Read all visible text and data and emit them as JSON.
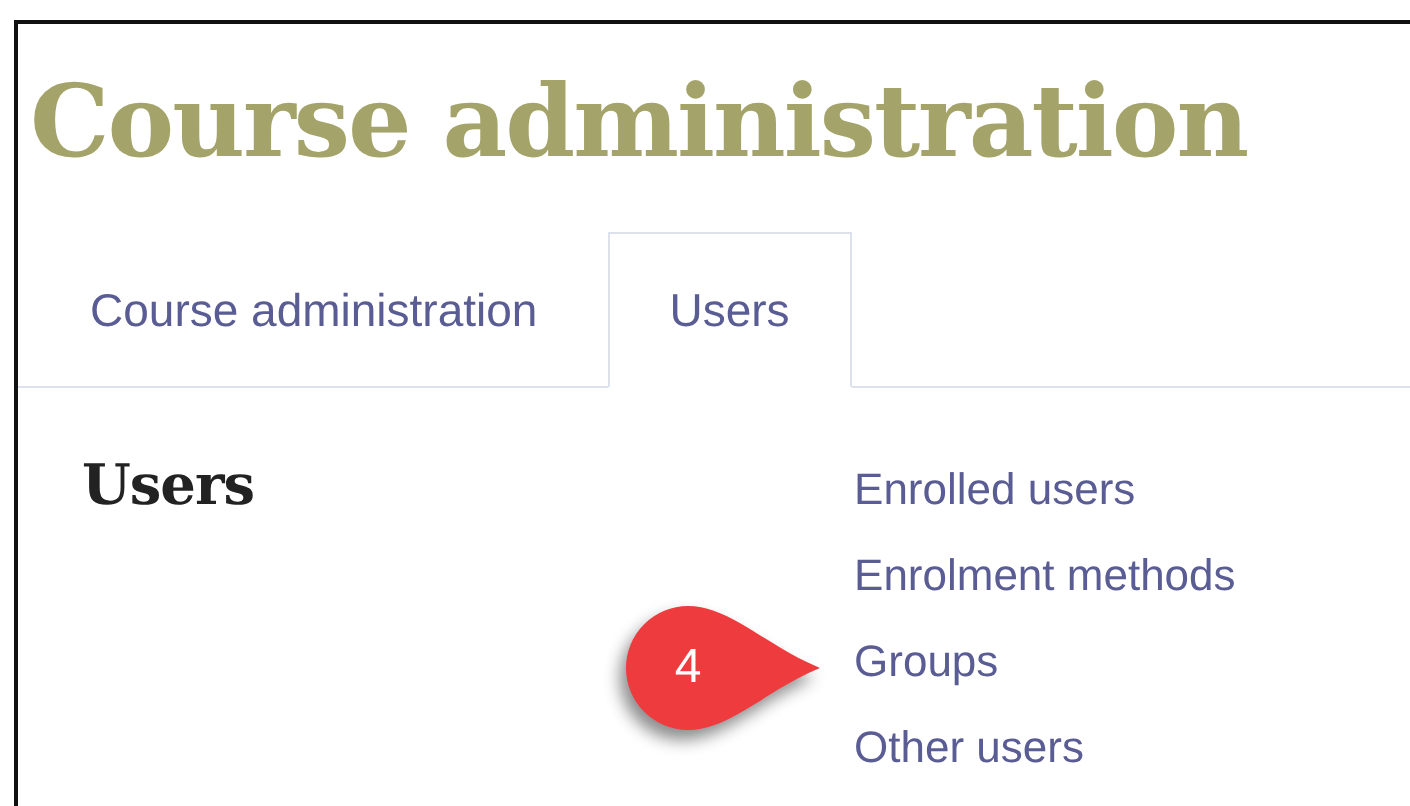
{
  "page_title": "Course administration",
  "tabs": [
    {
      "label": "Course administration",
      "selected": false
    },
    {
      "label": "Users",
      "selected": true
    }
  ],
  "section": {
    "heading": "Users",
    "links": [
      "Enrolled users",
      "Enrolment methods",
      "Groups",
      "Other users"
    ]
  },
  "callout": {
    "label": "4"
  }
}
